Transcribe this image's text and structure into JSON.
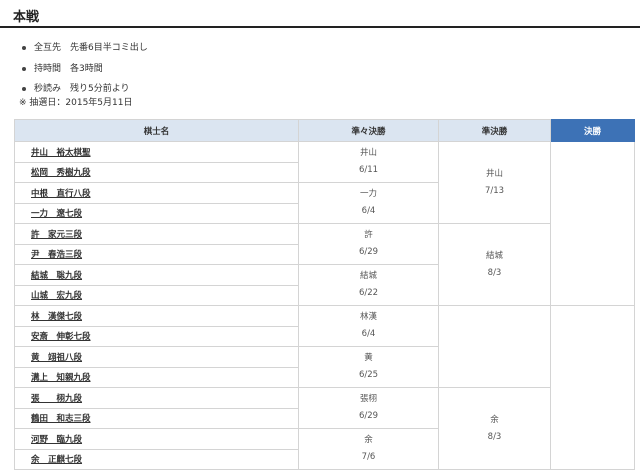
{
  "page_title": "本戦",
  "rules": [
    "全互先　先番6目半コミ出し",
    "持時間　各3時間",
    "秒読み　残り5分前より"
  ],
  "note": "※ 抽選日：2015年5月11日",
  "table": {
    "headers": [
      "棋士名",
      "準々決勝",
      "準決勝",
      "決勝"
    ],
    "players": [
      "井山　裕太棋聖",
      "松岡　秀樹九段",
      "中根　直行八段",
      "一力　遼七段",
      "許　家元三段",
      "尹　春浩三段",
      "結城　聡九段",
      "山城　宏九段",
      "林　漢傑七段",
      "安斎　伸彰七段",
      "黄　翊祖八段",
      "溝上　知親九段",
      "張　　栩九段",
      "鶴田　和志三段",
      "河野　臨九段",
      "余　正麒七段"
    ],
    "quarterfinals": [
      {
        "winner": "井山",
        "date": "6/11"
      },
      {
        "winner": "一力",
        "date": "6/4"
      },
      {
        "winner": "許",
        "date": "6/29"
      },
      {
        "winner": "結城",
        "date": "6/22"
      },
      {
        "winner": "林漢",
        "date": "6/4"
      },
      {
        "winner": "黄",
        "date": "6/25"
      },
      {
        "winner": "張栩",
        "date": "6/29"
      },
      {
        "winner": "余",
        "date": "7/6"
      }
    ],
    "semifinals": [
      {
        "winner": "井山",
        "date": "7/13"
      },
      {
        "winner": "結城",
        "date": "8/3"
      },
      {
        "winner": "",
        "date": ""
      },
      {
        "winner": "余",
        "date": "8/3"
      }
    ]
  }
}
